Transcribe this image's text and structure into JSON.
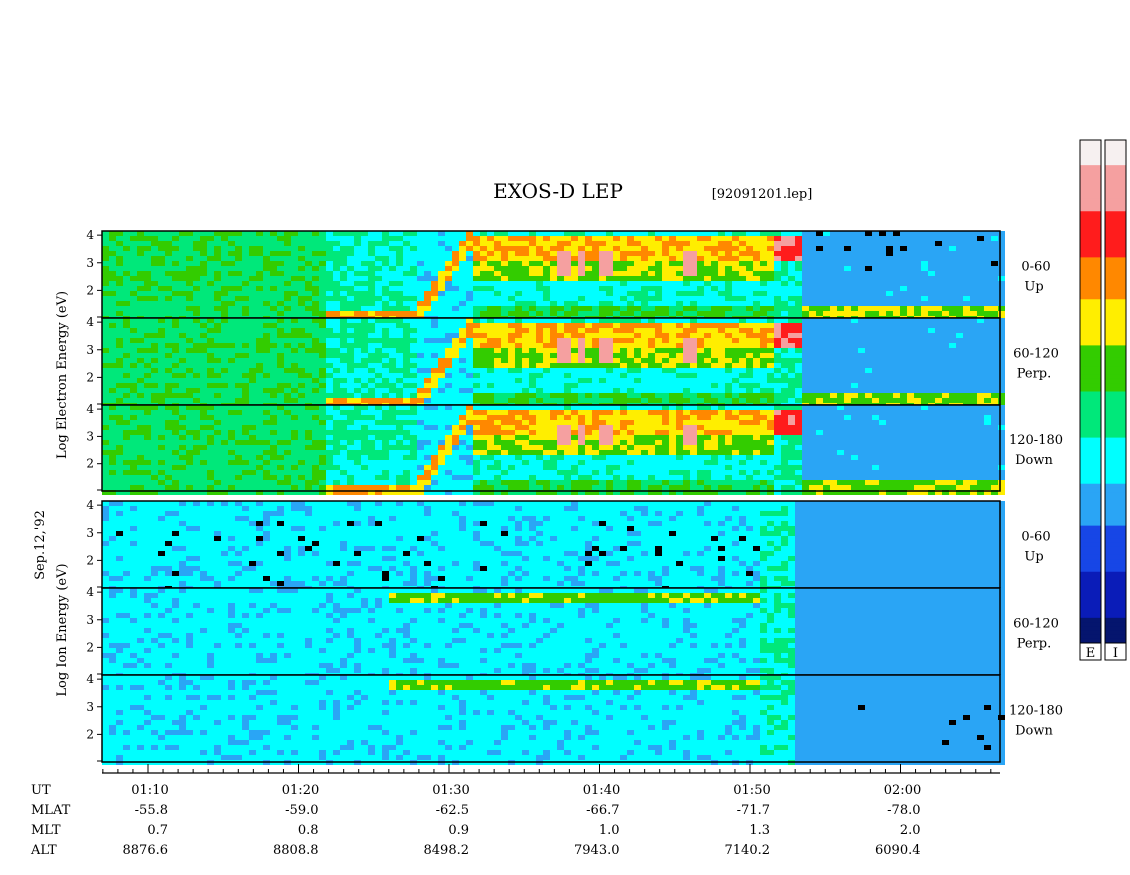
{
  "title": "EXOS-D LEP",
  "file_label": "[92091201.lep]",
  "date_label": "Sep.12,'92",
  "electron_ylabel": [
    "Log",
    "Electron",
    "Energy",
    "(eV)"
  ],
  "ion_ylabel": [
    "Log",
    "Ion",
    "Energy",
    "(eV)"
  ],
  "colorbar_labels": [
    "E",
    "I"
  ],
  "colors": {
    "background": "#ffffff",
    "axis": "#000000",
    "scale": [
      "#f6f0f0",
      "#f5a0a0",
      "#ff1c1c",
      "#ff8800",
      "#ffee00",
      "#33cc00",
      "#00e87a",
      "#00ffff",
      "#2aa5f5",
      "#1746e6",
      "#0a1cb8",
      "#05156e"
    ]
  },
  "footer": {
    "row_labels": [
      "UT",
      "MLAT",
      "MLT",
      "ALT"
    ],
    "columns": [
      {
        "ut": "01:10",
        "mlat": "-55.8",
        "mlt": "0.7",
        "alt": "8876.6"
      },
      {
        "ut": "01:20",
        "mlat": "-59.0",
        "mlt": "0.8",
        "alt": "8808.8"
      },
      {
        "ut": "01:30",
        "mlat": "-62.5",
        "mlt": "0.9",
        "alt": "8498.2"
      },
      {
        "ut": "01:40",
        "mlat": "-66.7",
        "mlt": "1.0",
        "alt": "7943.0"
      },
      {
        "ut": "01:50",
        "mlat": "-71.7",
        "mlt": "1.3",
        "alt": "7140.2"
      },
      {
        "ut": "02:00",
        "mlat": "-78.0",
        "mlt": "2.0",
        "alt": "6090.4"
      }
    ]
  },
  "chart_data": {
    "type": "heatmap",
    "title": "EXOS-D LEP",
    "x_axis": {
      "label": "UT",
      "ticks": [
        "01:10",
        "01:20",
        "01:30",
        "01:40",
        "01:50",
        "02:00"
      ],
      "range": [
        "01:06:52",
        "02:06:40"
      ]
    },
    "y_axis": {
      "label": "Log Energy (eV)",
      "ticks": [
        2,
        3,
        4
      ],
      "range": [
        1,
        4.15
      ]
    },
    "series": [
      {
        "particle": "Electron",
        "pitch": "0-60",
        "direction": "Up"
      },
      {
        "particle": "Electron",
        "pitch": "60-120",
        "direction": "Perp."
      },
      {
        "particle": "Electron",
        "pitch": "120-180",
        "direction": "Down"
      },
      {
        "particle": "Ion",
        "pitch": "0-60",
        "direction": "Up"
      },
      {
        "particle": "Ion",
        "pitch": "60-120",
        "direction": "Perp."
      },
      {
        "particle": "Ion",
        "pitch": "120-180",
        "direction": "Down"
      }
    ],
    "colorbars": [
      "E",
      "I"
    ]
  }
}
